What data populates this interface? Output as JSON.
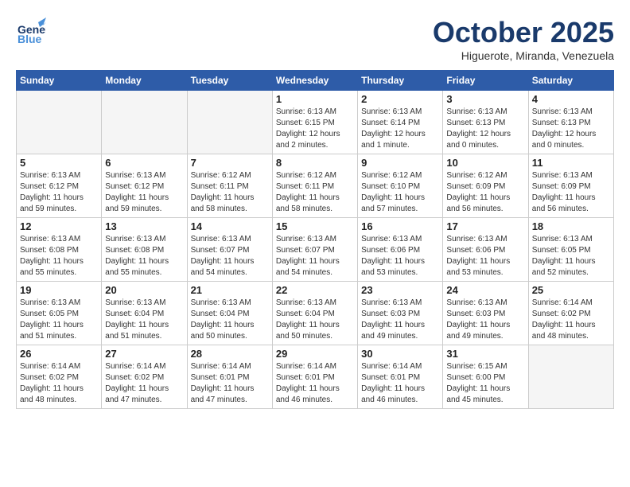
{
  "header": {
    "logo_line1": "General",
    "logo_line2": "Blue",
    "month": "October 2025",
    "location": "Higuerote, Miranda, Venezuela"
  },
  "weekdays": [
    "Sunday",
    "Monday",
    "Tuesday",
    "Wednesday",
    "Thursday",
    "Friday",
    "Saturday"
  ],
  "weeks": [
    [
      {
        "day": "",
        "info": ""
      },
      {
        "day": "",
        "info": ""
      },
      {
        "day": "",
        "info": ""
      },
      {
        "day": "1",
        "info": "Sunrise: 6:13 AM\nSunset: 6:15 PM\nDaylight: 12 hours\nand 2 minutes."
      },
      {
        "day": "2",
        "info": "Sunrise: 6:13 AM\nSunset: 6:14 PM\nDaylight: 12 hours\nand 1 minute."
      },
      {
        "day": "3",
        "info": "Sunrise: 6:13 AM\nSunset: 6:13 PM\nDaylight: 12 hours\nand 0 minutes."
      },
      {
        "day": "4",
        "info": "Sunrise: 6:13 AM\nSunset: 6:13 PM\nDaylight: 12 hours\nand 0 minutes."
      }
    ],
    [
      {
        "day": "5",
        "info": "Sunrise: 6:13 AM\nSunset: 6:12 PM\nDaylight: 11 hours\nand 59 minutes."
      },
      {
        "day": "6",
        "info": "Sunrise: 6:13 AM\nSunset: 6:12 PM\nDaylight: 11 hours\nand 59 minutes."
      },
      {
        "day": "7",
        "info": "Sunrise: 6:12 AM\nSunset: 6:11 PM\nDaylight: 11 hours\nand 58 minutes."
      },
      {
        "day": "8",
        "info": "Sunrise: 6:12 AM\nSunset: 6:11 PM\nDaylight: 11 hours\nand 58 minutes."
      },
      {
        "day": "9",
        "info": "Sunrise: 6:12 AM\nSunset: 6:10 PM\nDaylight: 11 hours\nand 57 minutes."
      },
      {
        "day": "10",
        "info": "Sunrise: 6:12 AM\nSunset: 6:09 PM\nDaylight: 11 hours\nand 56 minutes."
      },
      {
        "day": "11",
        "info": "Sunrise: 6:13 AM\nSunset: 6:09 PM\nDaylight: 11 hours\nand 56 minutes."
      }
    ],
    [
      {
        "day": "12",
        "info": "Sunrise: 6:13 AM\nSunset: 6:08 PM\nDaylight: 11 hours\nand 55 minutes."
      },
      {
        "day": "13",
        "info": "Sunrise: 6:13 AM\nSunset: 6:08 PM\nDaylight: 11 hours\nand 55 minutes."
      },
      {
        "day": "14",
        "info": "Sunrise: 6:13 AM\nSunset: 6:07 PM\nDaylight: 11 hours\nand 54 minutes."
      },
      {
        "day": "15",
        "info": "Sunrise: 6:13 AM\nSunset: 6:07 PM\nDaylight: 11 hours\nand 54 minutes."
      },
      {
        "day": "16",
        "info": "Sunrise: 6:13 AM\nSunset: 6:06 PM\nDaylight: 11 hours\nand 53 minutes."
      },
      {
        "day": "17",
        "info": "Sunrise: 6:13 AM\nSunset: 6:06 PM\nDaylight: 11 hours\nand 53 minutes."
      },
      {
        "day": "18",
        "info": "Sunrise: 6:13 AM\nSunset: 6:05 PM\nDaylight: 11 hours\nand 52 minutes."
      }
    ],
    [
      {
        "day": "19",
        "info": "Sunrise: 6:13 AM\nSunset: 6:05 PM\nDaylight: 11 hours\nand 51 minutes."
      },
      {
        "day": "20",
        "info": "Sunrise: 6:13 AM\nSunset: 6:04 PM\nDaylight: 11 hours\nand 51 minutes."
      },
      {
        "day": "21",
        "info": "Sunrise: 6:13 AM\nSunset: 6:04 PM\nDaylight: 11 hours\nand 50 minutes."
      },
      {
        "day": "22",
        "info": "Sunrise: 6:13 AM\nSunset: 6:04 PM\nDaylight: 11 hours\nand 50 minutes."
      },
      {
        "day": "23",
        "info": "Sunrise: 6:13 AM\nSunset: 6:03 PM\nDaylight: 11 hours\nand 49 minutes."
      },
      {
        "day": "24",
        "info": "Sunrise: 6:13 AM\nSunset: 6:03 PM\nDaylight: 11 hours\nand 49 minutes."
      },
      {
        "day": "25",
        "info": "Sunrise: 6:14 AM\nSunset: 6:02 PM\nDaylight: 11 hours\nand 48 minutes."
      }
    ],
    [
      {
        "day": "26",
        "info": "Sunrise: 6:14 AM\nSunset: 6:02 PM\nDaylight: 11 hours\nand 48 minutes."
      },
      {
        "day": "27",
        "info": "Sunrise: 6:14 AM\nSunset: 6:02 PM\nDaylight: 11 hours\nand 47 minutes."
      },
      {
        "day": "28",
        "info": "Sunrise: 6:14 AM\nSunset: 6:01 PM\nDaylight: 11 hours\nand 47 minutes."
      },
      {
        "day": "29",
        "info": "Sunrise: 6:14 AM\nSunset: 6:01 PM\nDaylight: 11 hours\nand 46 minutes."
      },
      {
        "day": "30",
        "info": "Sunrise: 6:14 AM\nSunset: 6:01 PM\nDaylight: 11 hours\nand 46 minutes."
      },
      {
        "day": "31",
        "info": "Sunrise: 6:15 AM\nSunset: 6:00 PM\nDaylight: 11 hours\nand 45 minutes."
      },
      {
        "day": "",
        "info": ""
      }
    ]
  ]
}
